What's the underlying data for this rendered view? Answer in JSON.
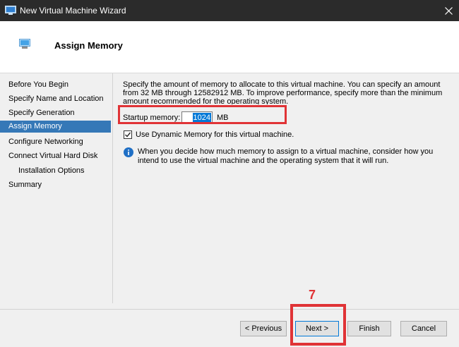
{
  "window": {
    "title": "New Virtual Machine Wizard",
    "app_icon": "hyper-v-icon",
    "close_icon": "close-icon"
  },
  "header": {
    "title": "Assign Memory",
    "icon": "memory-icon"
  },
  "nav": {
    "items": [
      {
        "label": "Before You Begin",
        "active": false,
        "indent": false
      },
      {
        "label": "Specify Name and Location",
        "active": false,
        "indent": false
      },
      {
        "label": "Specify Generation",
        "active": false,
        "indent": false
      },
      {
        "label": "Assign Memory",
        "active": true,
        "indent": false
      },
      {
        "label": "Configure Networking",
        "active": false,
        "indent": false
      },
      {
        "label": "Connect Virtual Hard Disk",
        "active": false,
        "indent": false
      },
      {
        "label": "Installation Options",
        "active": false,
        "indent": true
      },
      {
        "label": "Summary",
        "active": false,
        "indent": false
      }
    ]
  },
  "content": {
    "description": "Specify the amount of memory to allocate to this virtual machine. You can specify an amount from 32 MB through 12582912 MB. To improve performance, specify more than the minimum amount recommended for the operating system.",
    "startup_memory_label": "Startup memory:",
    "startup_memory_value": "1024",
    "startup_memory_unit": "MB",
    "dynamic_memory_label": "Use Dynamic Memory for this virtual machine.",
    "dynamic_memory_checked": true,
    "info_text": "When you decide how much memory to assign to a virtual machine, consider how you intend to use the virtual machine and the operating system that it will run."
  },
  "buttons": {
    "previous": "< Previous",
    "next": "Next >",
    "finish": "Finish",
    "cancel": "Cancel"
  },
  "annotation": {
    "step_number": "7",
    "color": "#e03336"
  },
  "colors": {
    "titlebar": "#2b2b2b",
    "nav_active": "#3578b7",
    "selection": "#0078d7",
    "info_icon": "#1f6fc5"
  }
}
